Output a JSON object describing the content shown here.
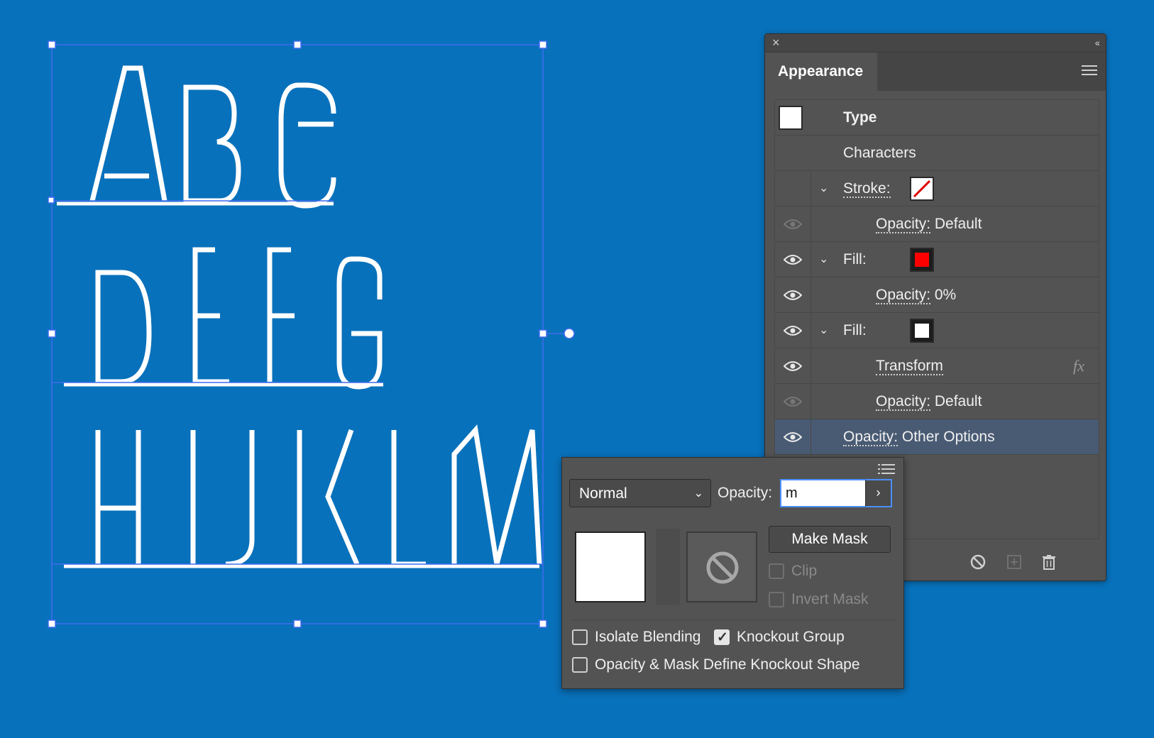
{
  "artboard": {
    "background_color": "#0871bb",
    "text_lines": [
      "ABC",
      "DEFG",
      "HIJKLM"
    ],
    "selection_color": "#3f6cf0"
  },
  "appearance_panel": {
    "title": "Appearance",
    "close_icon": "close-icon",
    "collapse_icon": "double-chevron-left-icon",
    "rows": [
      {
        "label": "Type",
        "swatch": "white"
      },
      {
        "label": "Characters"
      },
      {
        "label": "Stroke:",
        "swatch": "none-red-slash"
      },
      {
        "label": "Opacity:",
        "value": "Default"
      },
      {
        "label": "Fill:",
        "swatch": "red",
        "color": "#ff0000"
      },
      {
        "label": "Opacity:",
        "value": "0%"
      },
      {
        "label": "Fill:",
        "swatch": "white",
        "color": "#ffffff"
      },
      {
        "label": "Transform",
        "fx": "fx"
      },
      {
        "label": "Opacity:",
        "value": "Default"
      },
      {
        "label": "Opacity:",
        "value": "Other Options",
        "selected": true
      }
    ]
  },
  "opacity_popup": {
    "blend_mode": "Normal",
    "opacity_label": "Opacity:",
    "opacity_value": "m",
    "make_mask": "Make Mask",
    "clip": "Clip",
    "invert_mask": "Invert Mask",
    "isolate_blending": "Isolate Blending",
    "knockout_group": "Knockout Group",
    "knockout_group_checked": true,
    "define_knockout_shape": "Opacity & Mask Define Knockout Shape"
  }
}
